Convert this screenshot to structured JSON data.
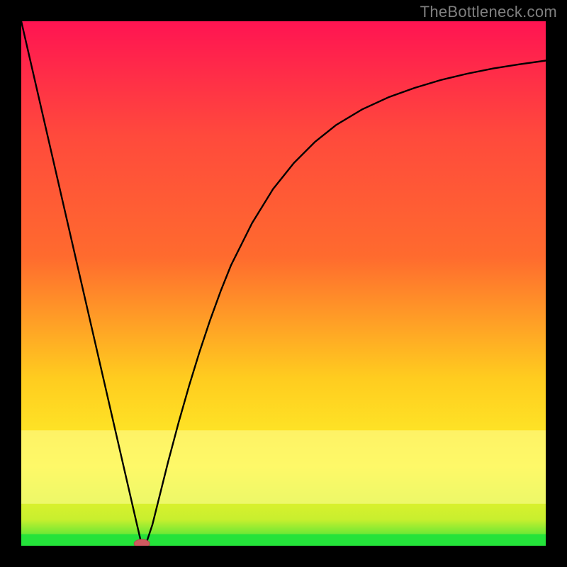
{
  "watermark": "TheBottleneck.com",
  "colors": {
    "bg": "#000000",
    "curve": "#000000",
    "marker_fill": "#cf5a60",
    "marker_stroke": "#b24a4f",
    "green_band": "#24e33a",
    "gradient_top": "#ff1452",
    "gradient_mid1": "#ff6b2e",
    "gradient_mid2": "#ffcc1f",
    "gradient_yellow": "#fef22a",
    "gradient_bottom": "#24e33a"
  },
  "chart_data": {
    "type": "line",
    "title": "",
    "xlabel": "",
    "ylabel": "",
    "xlim": [
      0,
      100
    ],
    "ylim": [
      0,
      100
    ],
    "x": [
      0,
      2,
      4,
      6,
      8,
      10,
      12,
      14,
      16,
      18,
      20,
      22,
      23,
      24,
      25,
      26,
      28,
      30,
      32,
      34,
      36,
      38,
      40,
      44,
      48,
      52,
      56,
      60,
      65,
      70,
      75,
      80,
      85,
      90,
      95,
      100
    ],
    "y": [
      100,
      91.3,
      82.6,
      73.9,
      65.2,
      56.5,
      47.8,
      39.1,
      30.4,
      21.7,
      13.0,
      4.3,
      0,
      1.0,
      4.0,
      8.0,
      16.0,
      23.5,
      30.5,
      37.0,
      43.0,
      48.5,
      53.5,
      61.5,
      68.0,
      73.0,
      77.0,
      80.2,
      83.2,
      85.5,
      87.3,
      88.8,
      90.0,
      91.0,
      91.8,
      92.5
    ],
    "minimum": {
      "x": 23,
      "y": 0
    }
  }
}
